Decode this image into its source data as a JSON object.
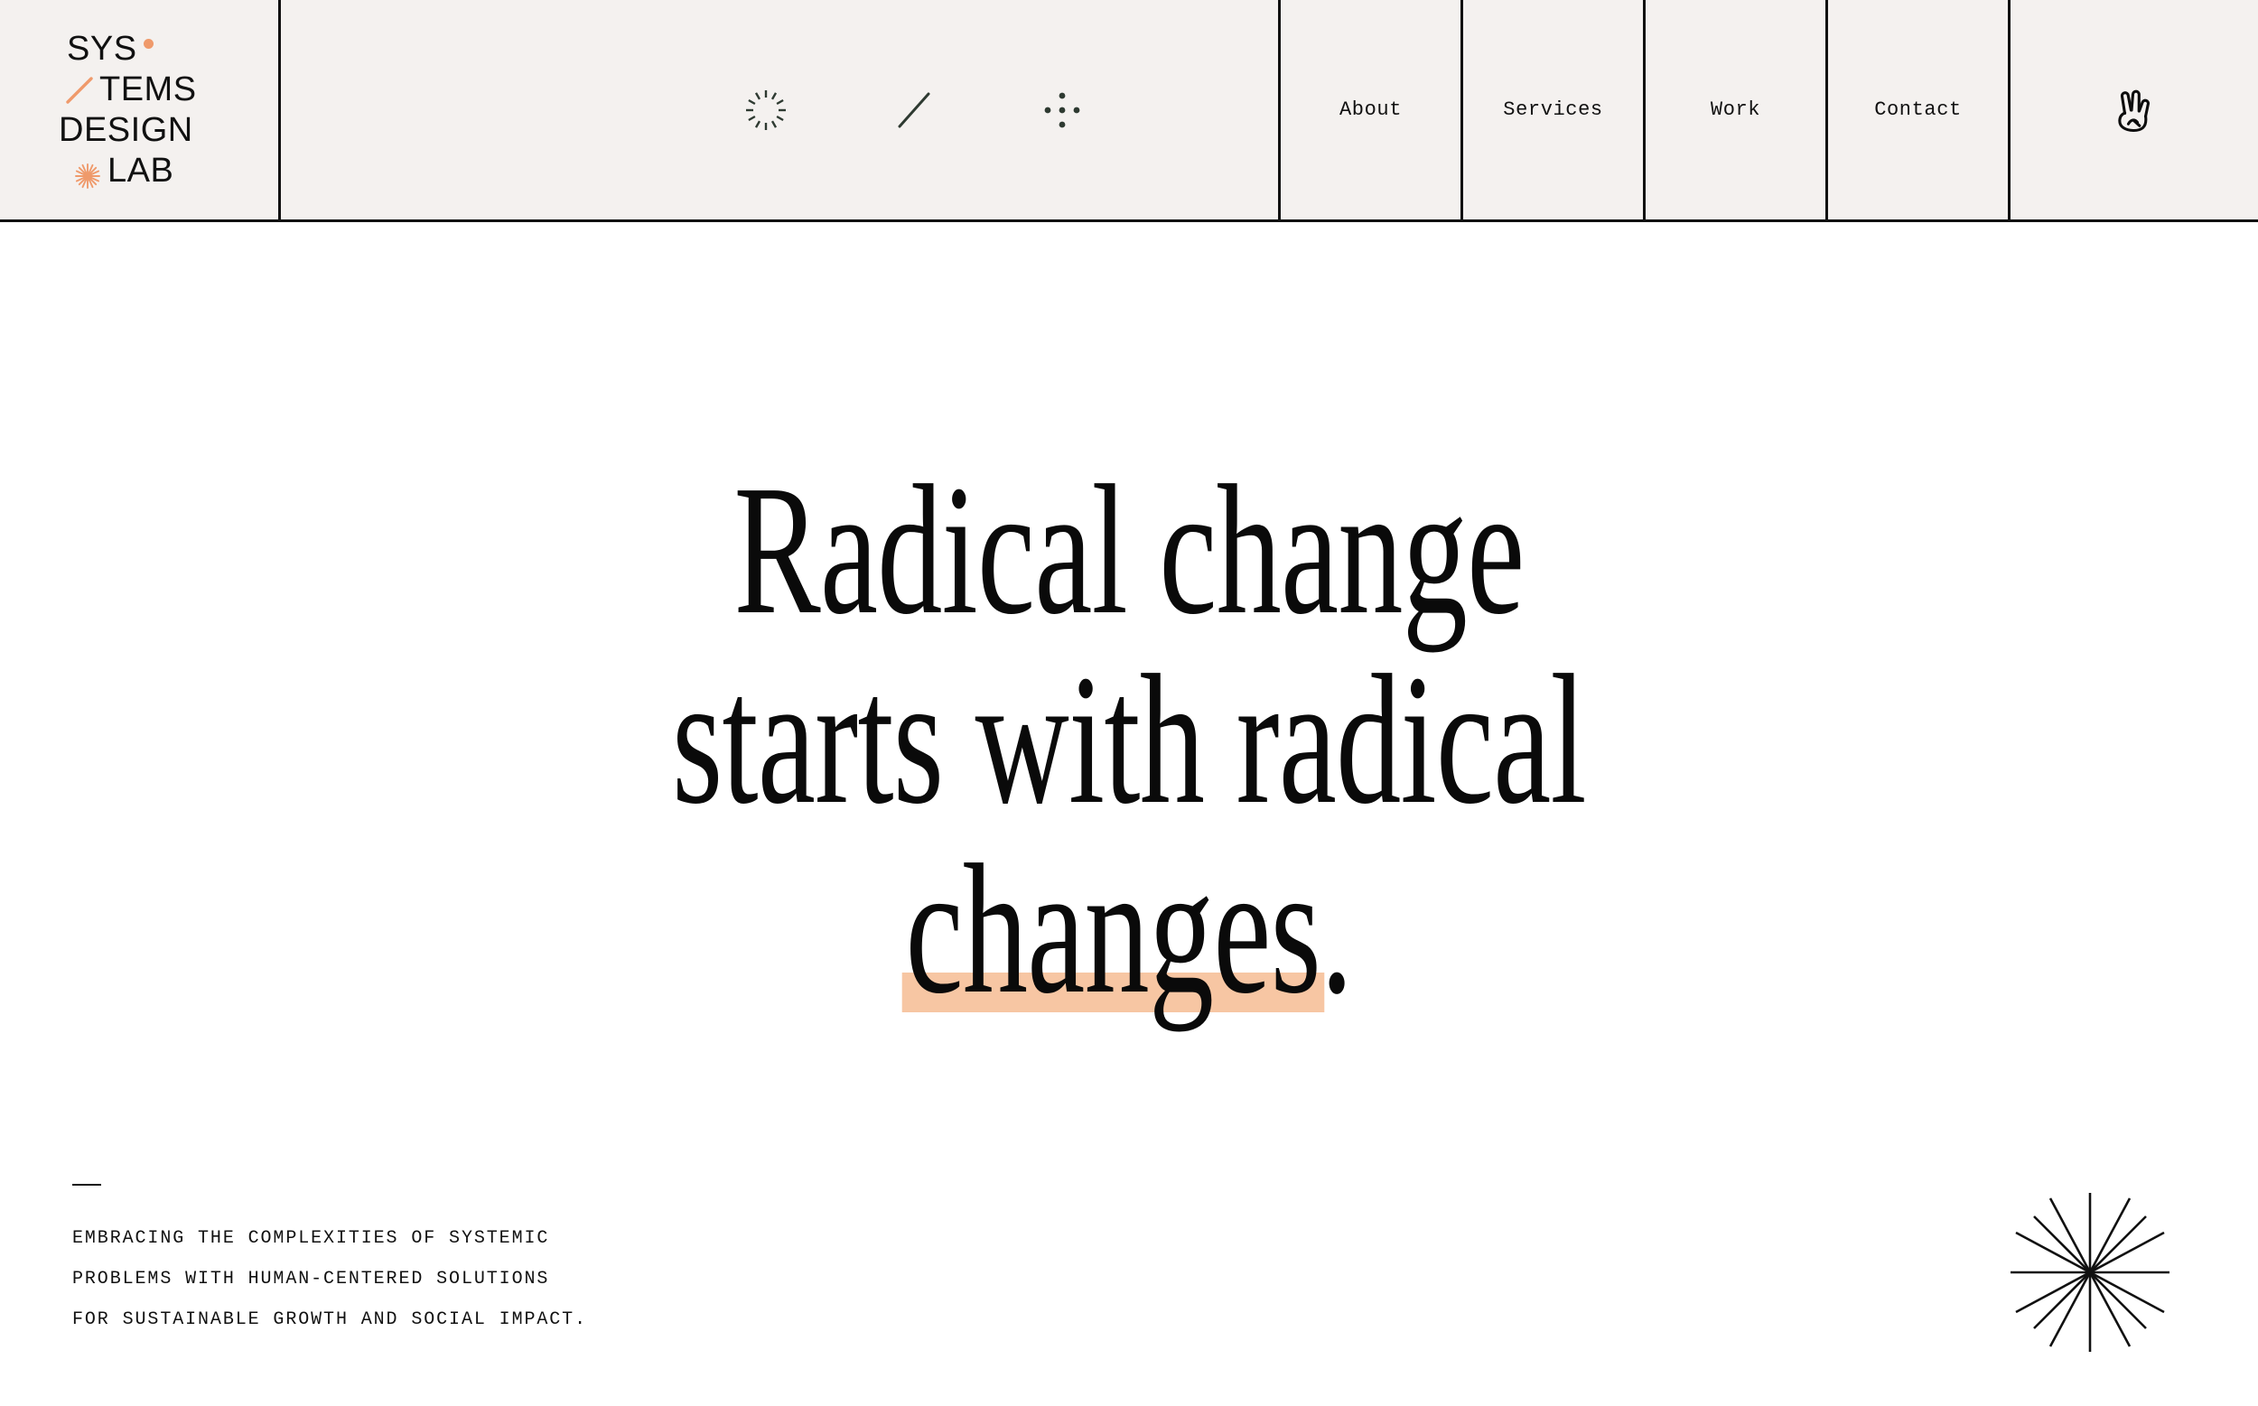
{
  "theme": {
    "background": "#ffffff",
    "header_background": "#f4f1ef",
    "ink": "#111111",
    "accent": "#ef9a6b",
    "highlight": "#f7c6a3"
  },
  "header": {
    "logo": {
      "line1": "SYS",
      "line2": "TEMS",
      "line3": "DESIGN",
      "line4": "LAB",
      "dot_icon": "dot-accent-icon",
      "slash_icon": "diagonal-slash-icon",
      "burst_icon": "sun-burst-icon"
    },
    "decorations": [
      {
        "name": "radial-burst-icon"
      },
      {
        "name": "diagonal-slash-icon"
      },
      {
        "name": "dot-cross-icon"
      }
    ],
    "nav": [
      {
        "label": "About"
      },
      {
        "label": "Services"
      },
      {
        "label": "Work"
      },
      {
        "label": "Contact"
      }
    ],
    "action_icon": "peace-hand-icon"
  },
  "hero": {
    "headline": {
      "line1": "Radical change",
      "line2": "starts with radical",
      "line3_highlight": "changes",
      "line3_tail": "."
    },
    "tagline": {
      "line1": "EMBRACING THE COMPLEXITIES OF SYSTEMIC",
      "line2": "PROBLEMS WITH HUMAN-CENTERED SOLUTIONS",
      "line3": "FOR SUSTAINABLE GROWTH AND SOCIAL IMPACT."
    },
    "ornament_icon": "starburst-icon"
  }
}
